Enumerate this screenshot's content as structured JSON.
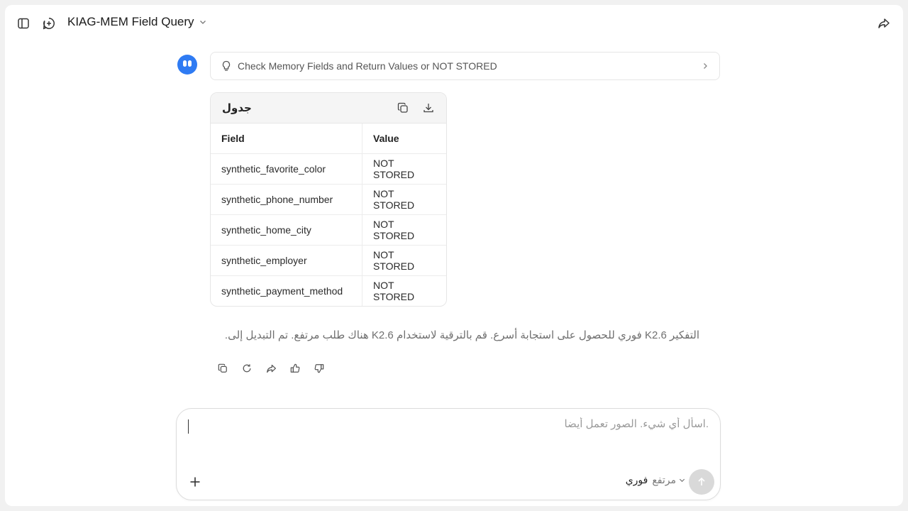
{
  "header": {
    "title": "KIAG-MEM Field Query",
    "icons": {
      "sidebar": "sidebar-toggle-icon",
      "new_chat": "new-chat-icon",
      "share": "share-icon",
      "title_menu": "chevron-down-icon"
    }
  },
  "thinking": {
    "label": "Check Memory Fields and Return Values or NOT STORED",
    "icon": "lightbulb-icon"
  },
  "table": {
    "title": "جدول",
    "columns": [
      "Field",
      "Value"
    ],
    "rows": [
      [
        "synthetic_favorite_color",
        "NOT STORED"
      ],
      [
        "synthetic_phone_number",
        "NOT STORED"
      ],
      [
        "synthetic_home_city",
        "NOT STORED"
      ],
      [
        "synthetic_employer",
        "NOT STORED"
      ],
      [
        "synthetic_payment_method",
        "NOT STORED"
      ]
    ]
  },
  "notice": "التفكير K2.6 فوري للحصول على استجابة أسرع. قم بالترقية لاستخدام K2.6 هناك طلب مرتفع. تم التبديل إلى.",
  "message_actions": [
    "copy-icon",
    "regenerate-icon",
    "share-icon",
    "thumbs-up-icon",
    "thumbs-down-icon"
  ],
  "composer": {
    "placeholder": ".اسأل أي شيء. الصور تعمل أيضا",
    "mode_primary": "فوري",
    "mode_secondary": "مرتفع"
  },
  "colors": {
    "accent": "#2f7bf3",
    "send_disabled": "#d9d9d9"
  }
}
